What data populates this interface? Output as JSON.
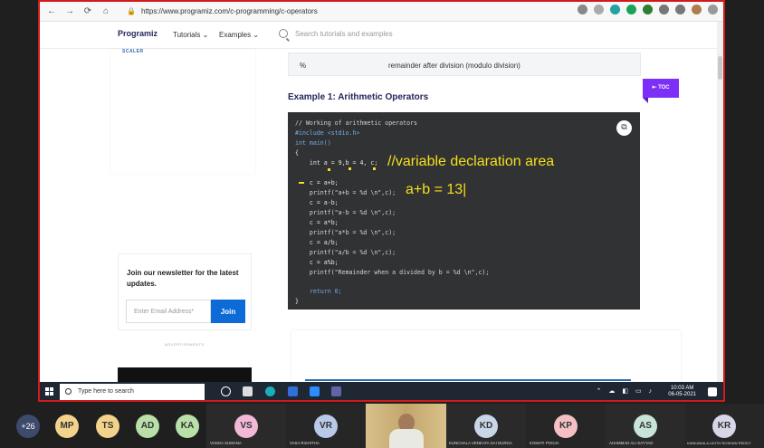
{
  "browser": {
    "url": "https://www.programiz.com/c-programming/c-operators",
    "back": "←",
    "forward": "→",
    "reload": "⟳",
    "home": "⌂"
  },
  "site": {
    "logo": "Programiz",
    "menu": [
      "Tutorials",
      "Examples"
    ],
    "search_placeholder": "Search tutorials and examples",
    "sidebar_brand": "SCALER",
    "newsletter_title": "Join our newsletter for the latest updates.",
    "email_placeholder": "Enter Email Address*",
    "join_label": "Join",
    "ad_label": "ADVERTISEMENTS"
  },
  "content": {
    "table_row": {
      "operator": "%",
      "description": "remainder after division (modulo division)"
    },
    "section_title": "Example 1: Arithmetic Operators",
    "toc_label": "TOC",
    "code_lines": [
      "// Working of arithmetic operators",
      "#include <stdio.h>",
      "int main()",
      "{",
      "    int a = 9,b = 4, c;",
      "",
      "    c = a+b;",
      "    printf(\"a+b = %d \\n\",c);",
      "    c = a-b;",
      "    printf(\"a-b = %d \\n\",c);",
      "    c = a*b;",
      "    printf(\"a*b = %d \\n\",c);",
      "    c = a/b;",
      "    printf(\"a/b = %d \\n\",c);",
      "    c = a%b;",
      "    printf(\"Remainder when a divided by b = %d \\n\",c);",
      "",
      "    return 0;",
      "}"
    ],
    "annotation_1": "//variable declaration area",
    "annotation_2": "a+b = 13|"
  },
  "taskbar": {
    "search_placeholder": "Type here to search",
    "time": "10:03 AM",
    "date": "06-05-2021"
  },
  "participants": {
    "overflow_count": "+26",
    "people": [
      {
        "initials": "MP",
        "name": "",
        "color": "#f3d38b"
      },
      {
        "initials": "TS",
        "name": "",
        "color": "#f3d38b"
      },
      {
        "initials": "AD",
        "name": "",
        "color": "#b8e0a8"
      },
      {
        "initials": "KA",
        "name": "",
        "color": "#b8e0a8"
      },
      {
        "initials": "VS",
        "name": "VANGA SUMANA",
        "color": "#f1b9d6"
      },
      {
        "initials": "VR",
        "name": "VASA RISHITHA",
        "color": "#b9c9e8"
      },
      {
        "initials": "KD",
        "name": "KUNCHALA VENKATA SAI DURGA",
        "color": "#c9d6e8"
      },
      {
        "initials": "KP",
        "name": "KOMATI POOJA",
        "color": "#f4c0c4"
      },
      {
        "initials": "AS",
        "name": "AHAMMAD ALI SAYYAD",
        "color": "#c8e4d8"
      },
      {
        "initials": "KR",
        "name": "KANKANALA LIKITH ROSHAN REDDY",
        "color": "#d6d6e8"
      }
    ]
  }
}
